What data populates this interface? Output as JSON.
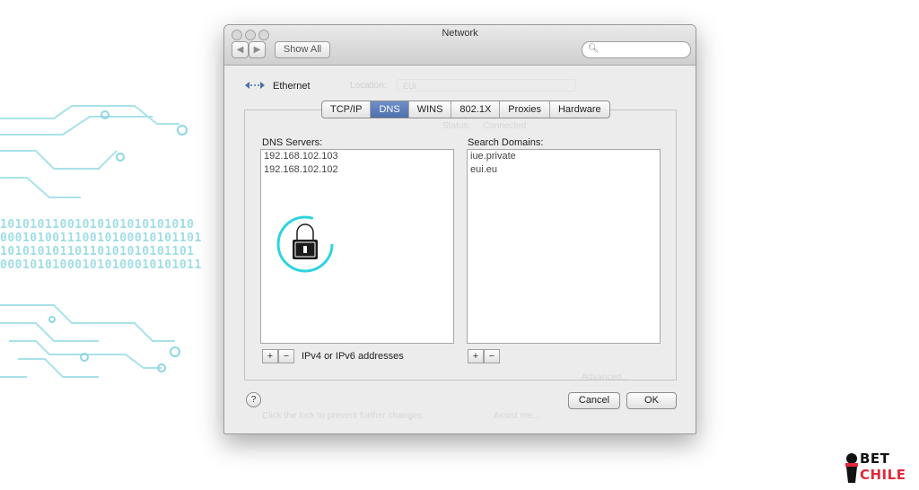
{
  "window": {
    "title": "Network",
    "show_all_label": "Show All",
    "back_label": "◀",
    "forward_label": "▶"
  },
  "header": {
    "service_name": "Ethernet",
    "location_label": "Location:",
    "location_value": "EUI"
  },
  "tabs": [
    {
      "label": "TCP/IP"
    },
    {
      "label": "DNS",
      "active": true
    },
    {
      "label": "WINS"
    },
    {
      "label": "802.1X"
    },
    {
      "label": "Proxies"
    },
    {
      "label": "Hardware"
    }
  ],
  "dns": {
    "servers_label": "DNS Servers:",
    "servers": [
      "192.168.102.103",
      "192.168.102.102"
    ],
    "domains_label": "Search Domains:",
    "domains": [
      "iue.private",
      "eui.eu"
    ],
    "hint": "IPv4 or IPv6 addresses",
    "add_label": "+",
    "remove_label": "−"
  },
  "background_panel": {
    "status": "Status:",
    "connected": "Connected",
    "advanced": "Advanced...",
    "lock_text": "Click the lock to prevent further changes.",
    "assist": "Assist me..."
  },
  "footer": {
    "help_label": "?",
    "cancel_label": "Cancel",
    "ok_label": "OK"
  },
  "decoration": {
    "binary": [
      "10101011001010101010101010",
      "000101001110010100010101101",
      "10101010110110101010101101",
      "000101010001010100010101011"
    ]
  },
  "logo": {
    "line1": "BET",
    "line2": "CHILE"
  },
  "colors": {
    "accent_tab": "#4e70ad",
    "circuit": "#9fdde6",
    "logo_red": "#e3283a"
  }
}
